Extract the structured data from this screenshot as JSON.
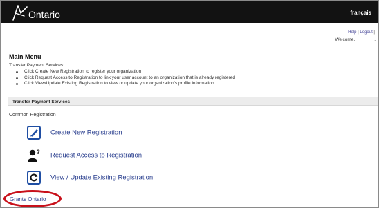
{
  "header": {
    "logo_text": "Ontario",
    "language_link": "français"
  },
  "util": {
    "open": "| ",
    "help": "Help",
    "sep": " | ",
    "logout": "Logout",
    "close": " |"
  },
  "welcome": {
    "label": "Welcome,",
    "trailing": ","
  },
  "main_menu": {
    "title": "Main Menu",
    "intro": "Transfer Payment Services:",
    "bullets": [
      "Click Create New Registration to register your organization",
      "Click Request Access to Registration to link your user account to an organization that is already registered",
      "Click View/Update Existing Registration to view or update your organization's profile information"
    ]
  },
  "section": {
    "title": "Transfer Payment Services",
    "common_label": "Common Registration",
    "actions": [
      {
        "label": "Create New Registration",
        "icon": "edit-icon"
      },
      {
        "label": "Request Access to Registration",
        "icon": "user-question-icon"
      },
      {
        "label": "View / Update Existing Registration",
        "icon": "refresh-icon"
      }
    ]
  },
  "footer_link": "Grants Ontario",
  "colors": {
    "header_bg": "#121212",
    "link": "#2a3f8f",
    "highlight": "#c8101a",
    "icon_blue": "#1f4ea3"
  }
}
